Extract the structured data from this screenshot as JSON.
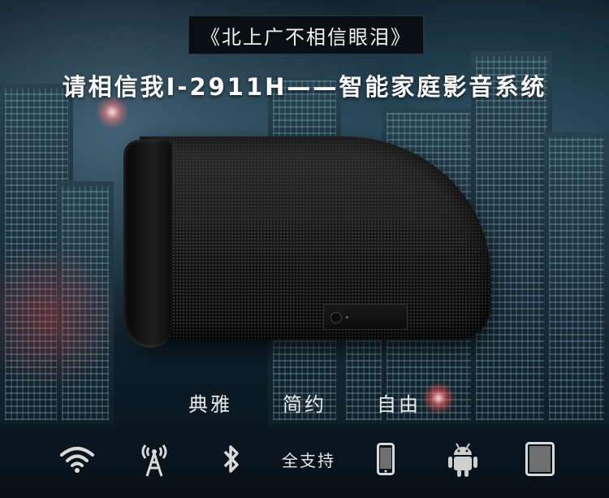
{
  "header": {
    "quote_title": "《北上广不相信眼泪》",
    "subtitle": "请相信我I-2911H——智能家庭影音系统"
  },
  "features": [
    "典雅",
    "简约",
    "自由"
  ],
  "support": {
    "icons": [
      "wifi-icon",
      "antenna-icon",
      "bluetooth-icon",
      "phone-icon",
      "android-icon",
      "tablet-icon"
    ],
    "label": "全支持"
  },
  "colors": {
    "text": "#ffffff",
    "icon": "#d9d9d9",
    "android_green_replaced_by_gray": "#cfcfcf"
  }
}
